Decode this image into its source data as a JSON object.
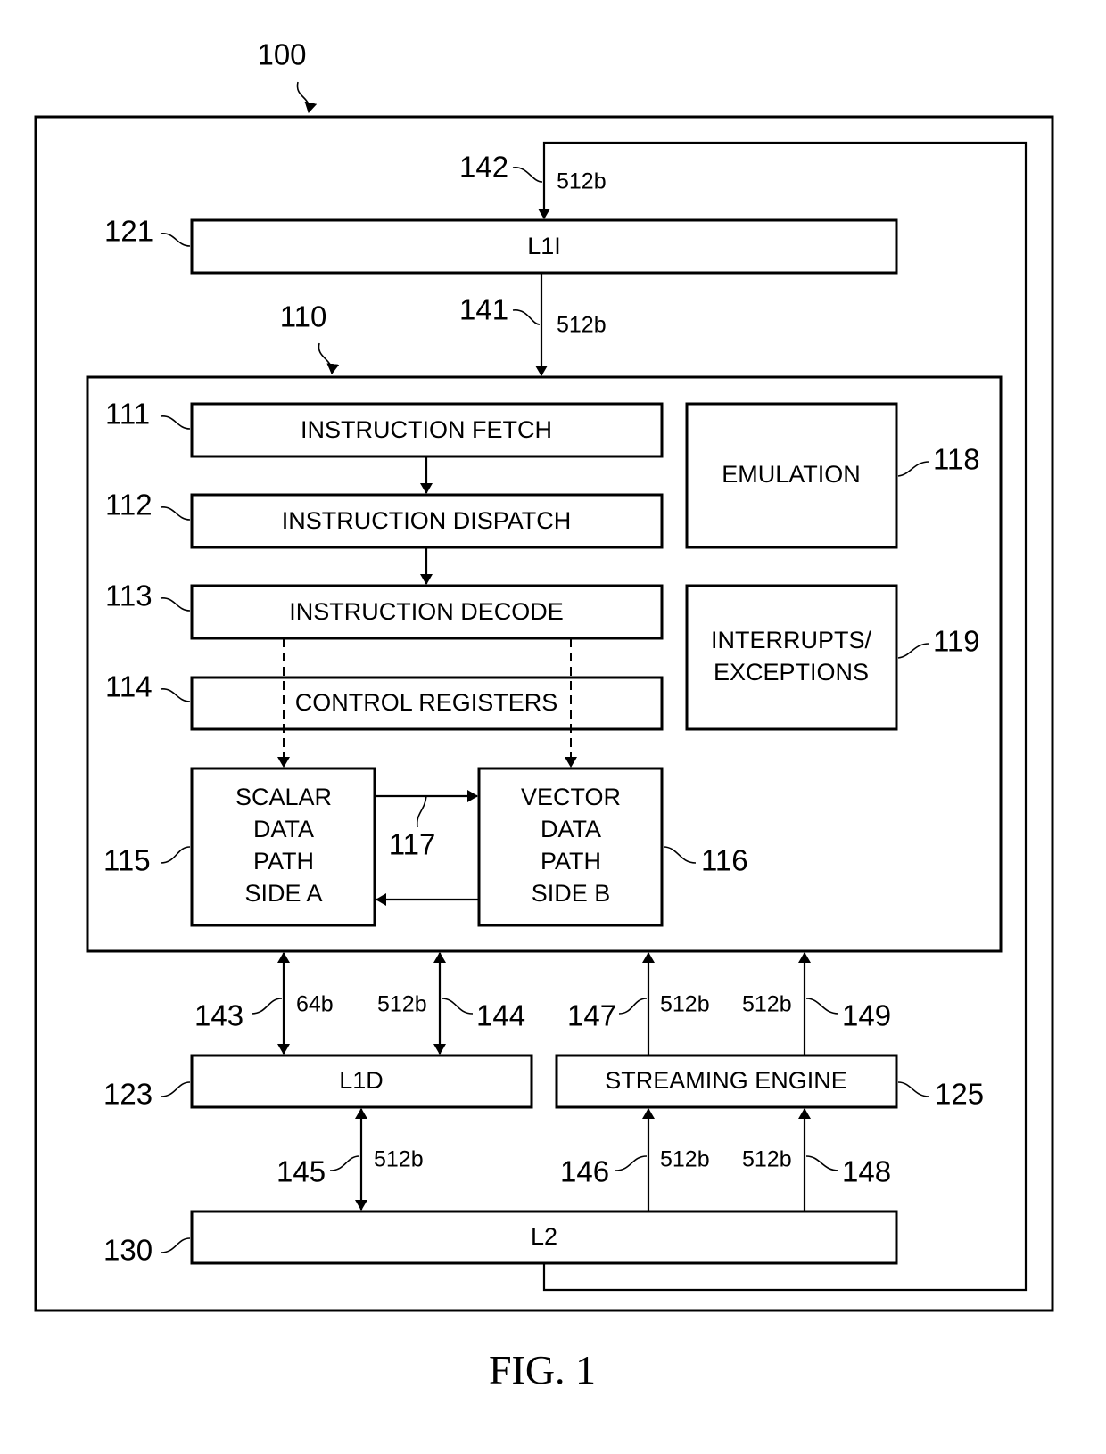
{
  "figure": {
    "caption": "FIG. 1",
    "ref_system": "100",
    "ref_core": "110"
  },
  "blocks": {
    "l1i": {
      "ref": "121",
      "label": "L1I"
    },
    "fetch": {
      "ref": "111",
      "label": "INSTRUCTION FETCH"
    },
    "dispatch": {
      "ref": "112",
      "label": "INSTRUCTION DISPATCH"
    },
    "decode": {
      "ref": "113",
      "label": "INSTRUCTION DECODE"
    },
    "control": {
      "ref": "114",
      "label": "CONTROL REGISTERS"
    },
    "emulation": {
      "ref": "118",
      "label": "EMULATION"
    },
    "interrupts": {
      "ref": "119",
      "lines": [
        "INTERRUPTS/",
        "EXCEPTIONS"
      ]
    },
    "scalar": {
      "ref": "115",
      "lines": [
        "SCALAR",
        "DATA",
        "PATH",
        "SIDE A"
      ]
    },
    "vector": {
      "ref": "116",
      "lines": [
        "VECTOR",
        "DATA",
        "PATH",
        "SIDE B"
      ]
    },
    "l1d": {
      "ref": "123",
      "label": "L1D"
    },
    "streaming": {
      "ref": "125",
      "label": "STREAMING ENGINE"
    },
    "l2": {
      "ref": "130",
      "label": "L2"
    }
  },
  "buses": {
    "b117": {
      "ref": "117"
    },
    "b141": {
      "ref": "141",
      "width": "512b"
    },
    "b142": {
      "ref": "142",
      "width": "512b"
    },
    "b143": {
      "ref": "143",
      "width": "64b"
    },
    "b144": {
      "ref": "144",
      "width": "512b"
    },
    "b145": {
      "ref": "145",
      "width": "512b"
    },
    "b146": {
      "ref": "146",
      "width": "512b"
    },
    "b147": {
      "ref": "147",
      "width": "512b"
    },
    "b148": {
      "ref": "148",
      "width": "512b"
    },
    "b149": {
      "ref": "149",
      "width": "512b"
    }
  }
}
